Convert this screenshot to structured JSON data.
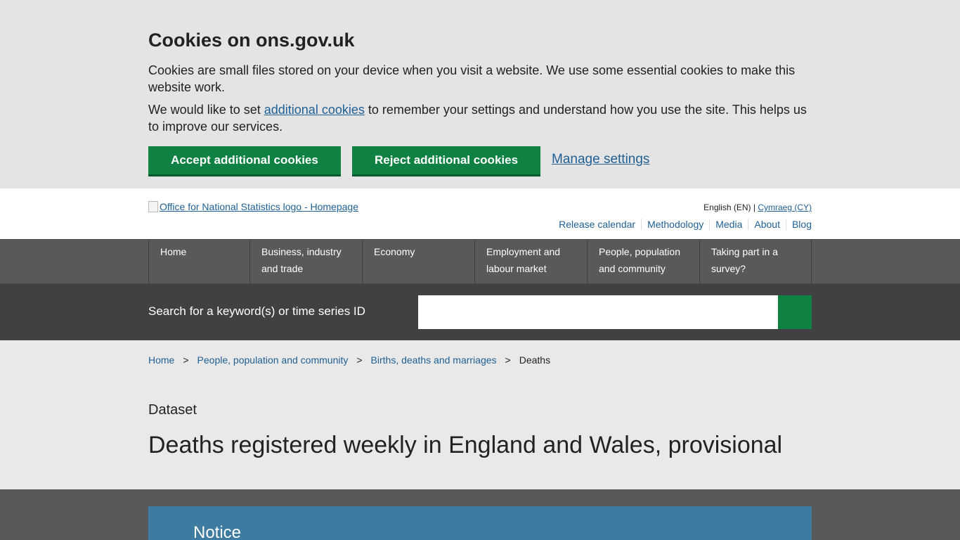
{
  "cookie_banner": {
    "title": "Cookies on ons.gov.uk",
    "paragraph1": "Cookies are small files stored on your device when you visit a website. We use some essential cookies to make this website work.",
    "paragraph2_before": "We would like to set ",
    "paragraph2_link": "additional cookies",
    "paragraph2_after": " to remember your settings and understand how you use the site. This helps us to improve our services.",
    "accept_label": "Accept additional cookies",
    "reject_label": "Reject additional cookies",
    "manage_label": "Manage settings"
  },
  "header": {
    "logo_alt": "Office for National Statistics logo - Homepage",
    "language_current": "English (EN)",
    "language_separator": "|",
    "language_other": "Cymraeg (CY)",
    "utility_links": [
      "Release calendar",
      "Methodology",
      "Media",
      "About",
      "Blog"
    ]
  },
  "nav": {
    "items": [
      {
        "line1": "Home",
        "line2": ""
      },
      {
        "line1": "Business, industry",
        "line2": "and trade"
      },
      {
        "line1": "Economy",
        "line2": ""
      },
      {
        "line1": "Employment and",
        "line2": "labour market"
      },
      {
        "line1": "People, population",
        "line2": "and community"
      },
      {
        "line1": "Taking part in a",
        "line2": "survey?"
      }
    ]
  },
  "search": {
    "label": "Search for a keyword(s) or time series ID",
    "value": ""
  },
  "breadcrumb": {
    "items": [
      "Home",
      "People, population and community",
      "Births, deaths and marriages"
    ],
    "separator": ">",
    "current": "Deaths"
  },
  "page": {
    "type": "Dataset",
    "title": "Deaths registered weekly in England and Wales, provisional"
  },
  "notice": {
    "title": "Notice"
  },
  "colors": {
    "accent_green": "#0f8243",
    "link_blue": "#206095",
    "nav_grey": "#595959",
    "search_dark": "#414042",
    "notice_blue": "#3e7ba0"
  }
}
